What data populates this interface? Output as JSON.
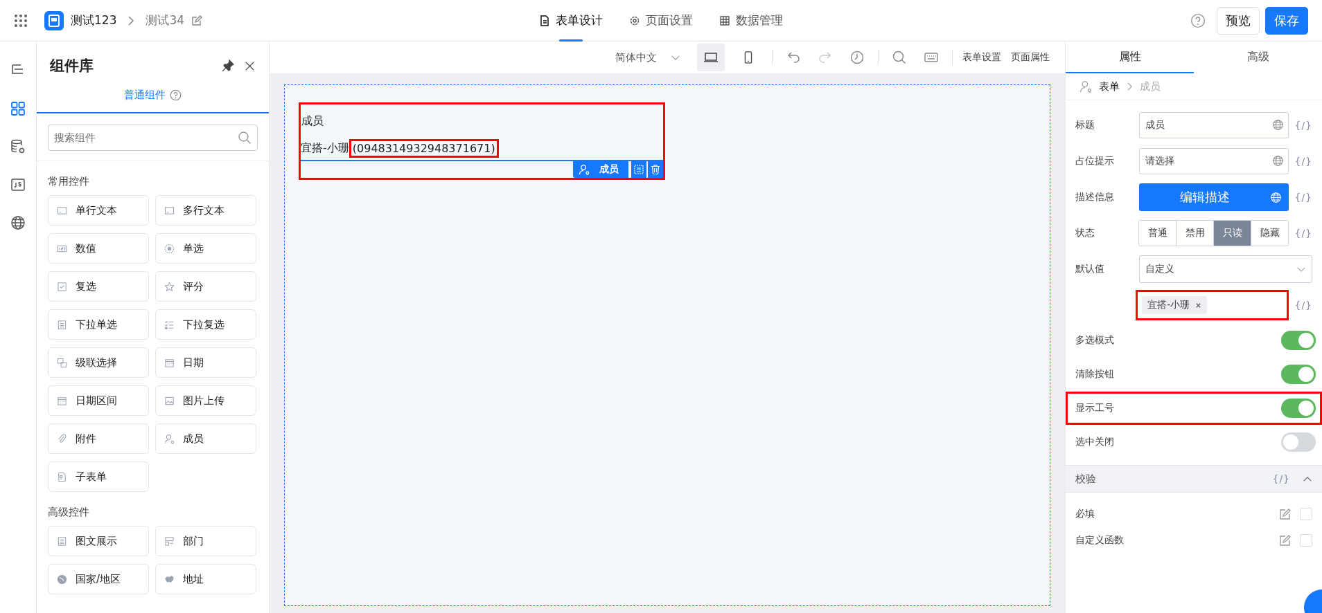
{
  "topbar": {
    "app_title": "测试123",
    "page_title": "测试34",
    "tabs": [
      {
        "label": "表单设计",
        "selected": true
      },
      {
        "label": "页面设置",
        "selected": false
      },
      {
        "label": "数据管理",
        "selected": false
      }
    ],
    "buttons": [
      {
        "label": "预览",
        "kind": "secondary"
      },
      {
        "label": "保存",
        "kind": "primary"
      }
    ]
  },
  "rail": [
    {
      "selected": false
    },
    {
      "selected": true
    },
    {
      "selected": false
    },
    {
      "selected": false
    },
    {
      "selected": false
    }
  ],
  "library": {
    "title": "组件库",
    "tabs": [
      {
        "label": "普通组件",
        "selected": true
      }
    ],
    "search": {
      "placeholder": "搜索组件"
    },
    "groups": [
      {
        "title": "常用控件",
        "items": [
          "单行文本",
          "多行文本",
          "数值",
          "单选",
          "复选",
          "评分",
          "下拉单选",
          "下拉复选",
          "级联选择",
          "日期",
          "日期区间",
          "图片上传",
          "附件",
          "成员",
          "子表单"
        ]
      },
      {
        "title": "高级控件",
        "items": [
          "图文展示",
          "部门",
          "国家/地区",
          "地址"
        ]
      }
    ]
  },
  "toolbar": {
    "language": "简体中文",
    "devices": [
      {
        "selected": true
      },
      {
        "selected": false
      }
    ],
    "links": [
      "表单设置",
      "页面属性"
    ]
  },
  "canvas": {
    "field": {
      "label": "成员",
      "name": "宜搭-小珊",
      "employee_id": "(0948314932948371671)",
      "highlighted": true,
      "id_highlighted": true,
      "badge": "成员"
    }
  },
  "panel": {
    "tabs": [
      {
        "label": "属性",
        "selected": true
      },
      {
        "label": "高级",
        "selected": false
      }
    ],
    "breadcrumb": [
      "表单",
      "成员"
    ],
    "rows": [
      {
        "kind": "input",
        "label": "标题",
        "value": "成员",
        "expression": "{/}"
      },
      {
        "kind": "input",
        "label": "占位提示",
        "value": "请选择",
        "expression": "{/}"
      },
      {
        "kind": "button",
        "label": "描述信息",
        "text": "编辑描述",
        "expression": "{/}"
      },
      {
        "kind": "segmented",
        "label": "状态",
        "options": [
          {
            "label": "普通",
            "selected": false
          },
          {
            "label": "禁用",
            "selected": false
          },
          {
            "label": "只读",
            "selected": true
          },
          {
            "label": "隐藏",
            "selected": false
          }
        ],
        "expression": "{/}"
      },
      {
        "kind": "select",
        "label": "默认值",
        "value": "自定义"
      },
      {
        "kind": "tags",
        "tags": [
          "宜搭-小珊"
        ],
        "highlighted": true,
        "expression": "{/}"
      },
      {
        "kind": "toggle",
        "label": "多选模式",
        "on": true,
        "highlighted": false
      },
      {
        "kind": "toggle",
        "label": "清除按钮",
        "on": true,
        "highlighted": false
      },
      {
        "kind": "toggle",
        "label": "显示工号",
        "on": true,
        "highlighted": true
      },
      {
        "kind": "toggle",
        "label": "选中关闭",
        "on": false,
        "highlighted": false
      }
    ],
    "validation": {
      "title": "校验",
      "expression": "{/}",
      "expanded": true,
      "rows": [
        {
          "label": "必填",
          "checked": false
        },
        {
          "label": "自定义函数",
          "checked": false
        }
      ]
    }
  }
}
